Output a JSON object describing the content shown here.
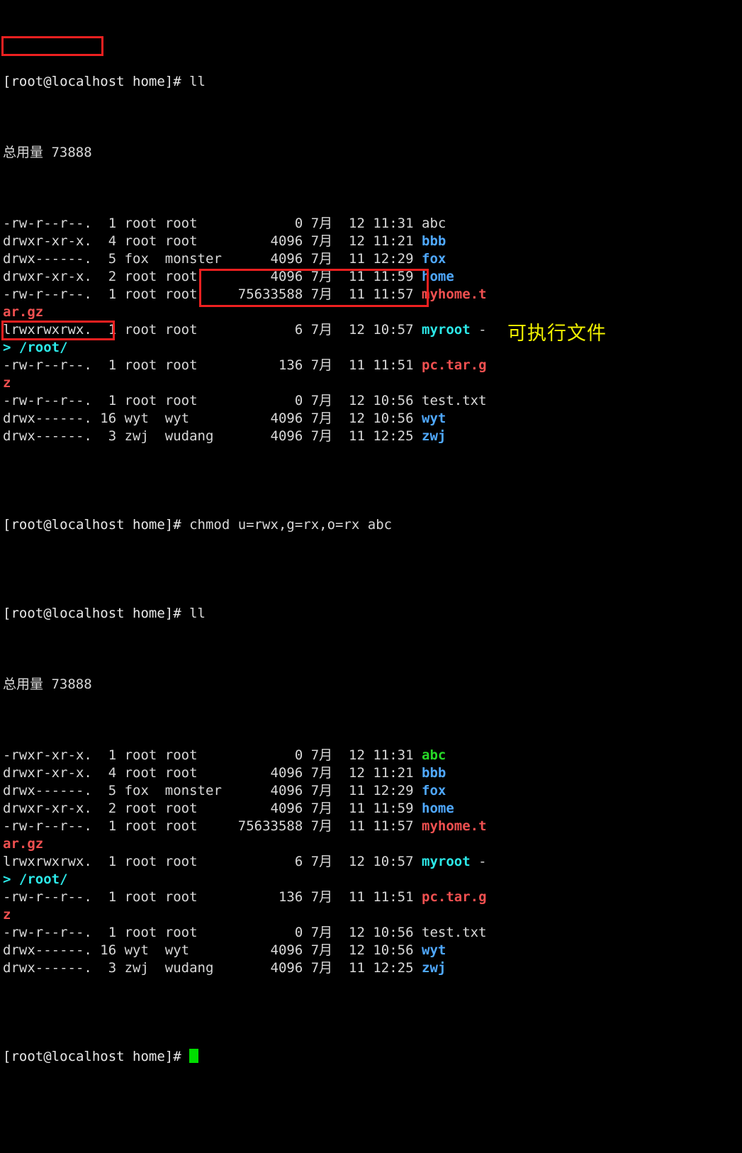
{
  "terminal": {
    "window_title": "",
    "background_color": "#000000",
    "foreground_color": "#d8d8d8",
    "prompt": "[root@localhost home]# ",
    "total_label_1": "总用量 73888",
    "total_label_2": "总用量 73888",
    "cursor": "block-cursor",
    "colors": {
      "white": "#d8d8d8",
      "dir_blue": "#3f8fd2",
      "archive_red": "#f05050",
      "symlink_cyan": "#2ce8e8",
      "exec_green": "#27d827",
      "annotation_red": "#ef2020",
      "annotation_yellow": "#f2f200",
      "cursor_green": "#00dd00"
    }
  },
  "session": {
    "cmd_1": "ll",
    "cmd_2": "chmod u=rwx,g=rx,o=rx abc",
    "cmd_3": "ll"
  },
  "listing_before": {
    "total": "总用量 73888",
    "rows": [
      {
        "perm": "-rw-r--r--.",
        "links": " 1",
        "user": "root",
        "group": "root   ",
        "size": "        0",
        "month": "7月",
        "day": "12",
        "time": "11:31",
        "name": "abc",
        "name_class": "w",
        "suffix": ""
      },
      {
        "perm": "drwxr-xr-x.",
        "links": " 4",
        "user": "root",
        "group": "root   ",
        "size": "     4096",
        "month": "7月",
        "day": "12",
        "time": "11:21",
        "name": "bbb",
        "name_class": "dirb",
        "suffix": ""
      },
      {
        "perm": "drwx------.",
        "links": " 5",
        "user": "fox ",
        "group": "monster",
        "size": "     4096",
        "month": "7月",
        "day": "11",
        "time": "12:29",
        "name": "fox",
        "name_class": "dirb",
        "suffix": ""
      },
      {
        "perm": "drwxr-xr-x.",
        "links": " 2",
        "user": "root",
        "group": "root   ",
        "size": "     4096",
        "month": "7月",
        "day": "11",
        "time": "11:59",
        "name": "home",
        "name_class": "dirb",
        "suffix": ""
      },
      {
        "perm": "-rw-r--r--.",
        "links": " 1",
        "user": "root",
        "group": "root   ",
        "size": " 75633588",
        "month": "7月",
        "day": "11",
        "time": "11:57",
        "name": "myhome.t",
        "name_class": "arc",
        "suffix": "",
        "wrap": "ar.gz",
        "wrap_class": "arc"
      },
      {
        "perm": "lrwxrwxrwx.",
        "links": " 1",
        "user": "root",
        "group": "root   ",
        "size": "        6",
        "month": "7月",
        "day": "12",
        "time": "10:57",
        "name": "myroot",
        "name_class": "lnk",
        "suffix": " -",
        "wrap": "> /root/",
        "wrap_class": "lnk"
      },
      {
        "perm": "-rw-r--r--.",
        "links": " 1",
        "user": "root",
        "group": "root   ",
        "size": "      136",
        "month": "7月",
        "day": "11",
        "time": "11:51",
        "name": "pc.tar.g",
        "name_class": "arc",
        "suffix": "",
        "wrap": "z",
        "wrap_class": "arc"
      },
      {
        "perm": "-rw-r--r--.",
        "links": " 1",
        "user": "root",
        "group": "root   ",
        "size": "        0",
        "month": "7月",
        "day": "12",
        "time": "10:56",
        "name": "test.txt",
        "name_class": "w",
        "suffix": ""
      },
      {
        "perm": "drwx------.",
        "links": "16",
        "user": "wyt ",
        "group": "wyt    ",
        "size": "     4096",
        "month": "7月",
        "day": "12",
        "time": "10:56",
        "name": "wyt",
        "name_class": "dirb",
        "suffix": ""
      },
      {
        "perm": "drwx------.",
        "links": " 3",
        "user": "zwj ",
        "group": "wudang ",
        "size": "     4096",
        "month": "7月",
        "day": "11",
        "time": "12:25",
        "name": "zwj",
        "name_class": "dirb",
        "suffix": ""
      }
    ]
  },
  "listing_after": {
    "total": "总用量 73888",
    "rows": [
      {
        "perm": "-rwxr-xr-x.",
        "links": " 1",
        "user": "root",
        "group": "root   ",
        "size": "        0",
        "month": "7月",
        "day": "12",
        "time": "11:31",
        "name": "abc",
        "name_class": "exe",
        "suffix": ""
      },
      {
        "perm": "drwxr-xr-x.",
        "links": " 4",
        "user": "root",
        "group": "root   ",
        "size": "     4096",
        "month": "7月",
        "day": "12",
        "time": "11:21",
        "name": "bbb",
        "name_class": "dirb",
        "suffix": ""
      },
      {
        "perm": "drwx------.",
        "links": " 5",
        "user": "fox ",
        "group": "monster",
        "size": "     4096",
        "month": "7月",
        "day": "11",
        "time": "12:29",
        "name": "fox",
        "name_class": "dirb",
        "suffix": ""
      },
      {
        "perm": "drwxr-xr-x.",
        "links": " 2",
        "user": "root",
        "group": "root   ",
        "size": "     4096",
        "month": "7月",
        "day": "11",
        "time": "11:59",
        "name": "home",
        "name_class": "dirb",
        "suffix": ""
      },
      {
        "perm": "-rw-r--r--.",
        "links": " 1",
        "user": "root",
        "group": "root   ",
        "size": " 75633588",
        "month": "7月",
        "day": "11",
        "time": "11:57",
        "name": "myhome.t",
        "name_class": "arc",
        "suffix": "",
        "wrap": "ar.gz",
        "wrap_class": "arc"
      },
      {
        "perm": "lrwxrwxrwx.",
        "links": " 1",
        "user": "root",
        "group": "root   ",
        "size": "        6",
        "month": "7月",
        "day": "12",
        "time": "10:57",
        "name": "myroot",
        "name_class": "lnk",
        "suffix": " -",
        "wrap": "> /root/",
        "wrap_class": "lnk"
      },
      {
        "perm": "-rw-r--r--.",
        "links": " 1",
        "user": "root",
        "group": "root   ",
        "size": "      136",
        "month": "7月",
        "day": "11",
        "time": "11:51",
        "name": "pc.tar.g",
        "name_class": "arc",
        "suffix": "",
        "wrap": "z",
        "wrap_class": "arc"
      },
      {
        "perm": "-rw-r--r--.",
        "links": " 1",
        "user": "root",
        "group": "root   ",
        "size": "        0",
        "month": "7月",
        "day": "12",
        "time": "10:56",
        "name": "test.txt",
        "name_class": "w",
        "suffix": ""
      },
      {
        "perm": "drwx------.",
        "links": "16",
        "user": "wyt ",
        "group": "wyt    ",
        "size": "     4096",
        "month": "7月",
        "day": "12",
        "time": "10:56",
        "name": "wyt",
        "name_class": "dirb",
        "suffix": ""
      },
      {
        "perm": "drwx------.",
        "links": " 3",
        "user": "zwj ",
        "group": "wudang ",
        "size": "     4096",
        "month": "7月",
        "day": "11",
        "time": "12:25",
        "name": "zwj",
        "name_class": "dirb",
        "suffix": ""
      }
    ]
  },
  "annotations": {
    "note_text": "可执行文件",
    "box_perm_before_label": "-rw-r--r--.",
    "box_command_label": "chmod u=rwx,g=rx,o=rx abc / ll",
    "box_perm_after_label": "-rwxr-xr-x."
  }
}
